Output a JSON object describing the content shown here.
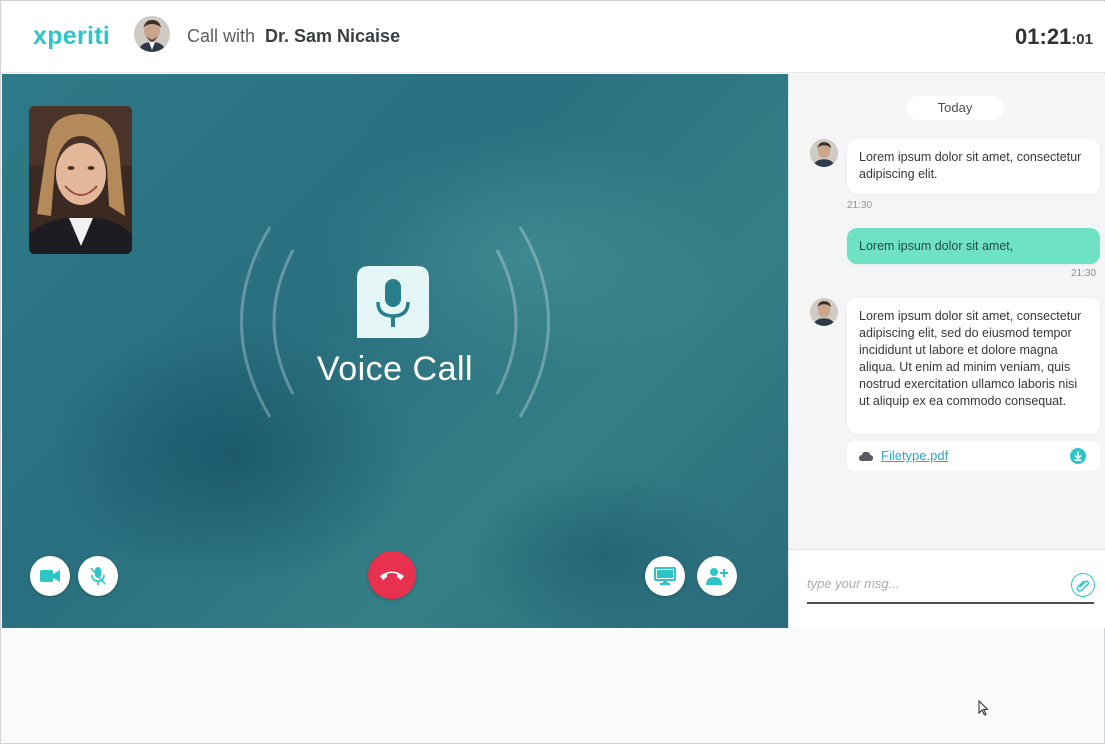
{
  "header": {
    "logo": "xperiti",
    "call_prefix": "Call with",
    "doctor_name": "Dr. Sam Nicaise",
    "timer_main": "01:21",
    "timer_sub": ":01"
  },
  "stage": {
    "voice_label": "Voice Call",
    "controls_left": [
      {
        "name": "camera-button",
        "icon": "video-camera-icon"
      },
      {
        "name": "mute-button",
        "icon": "mic-off-icon"
      }
    ],
    "end_call": {
      "icon": "phone-hangup-icon",
      "color": "#e8304f"
    },
    "controls_right": [
      {
        "name": "screen-share-button",
        "icon": "monitor-icon"
      },
      {
        "name": "add-participant-button",
        "icon": "add-user-icon"
      }
    ]
  },
  "chat": {
    "date_divider": "Today",
    "messages": [
      {
        "from": "doctor",
        "text": "Lorem ipsum dolor sit amet, consectetur adipiscing elit.",
        "time": "21:30"
      },
      {
        "from": "me",
        "text": "Lorem ipsum dolor sit amet,",
        "time": "21:30"
      },
      {
        "from": "doctor",
        "text": "Lorem ipsum dolor sit amet, consectetur adipiscing elit, sed do eiusmod tempor incididunt ut labore et dolore magna aliqua. Ut enim ad minim veniam, quis nostrud exercitation ullamco laboris nisi ut aliquip ex ea commodo consequat."
      }
    ],
    "attachment": {
      "file_name": "Filetype.pdf"
    },
    "composer": {
      "placeholder": "type your msg...",
      "value": ""
    }
  },
  "colors": {
    "brand": "#2ec5c9",
    "my_bubble": "#6fe2c6",
    "end_call": "#e8304f"
  }
}
